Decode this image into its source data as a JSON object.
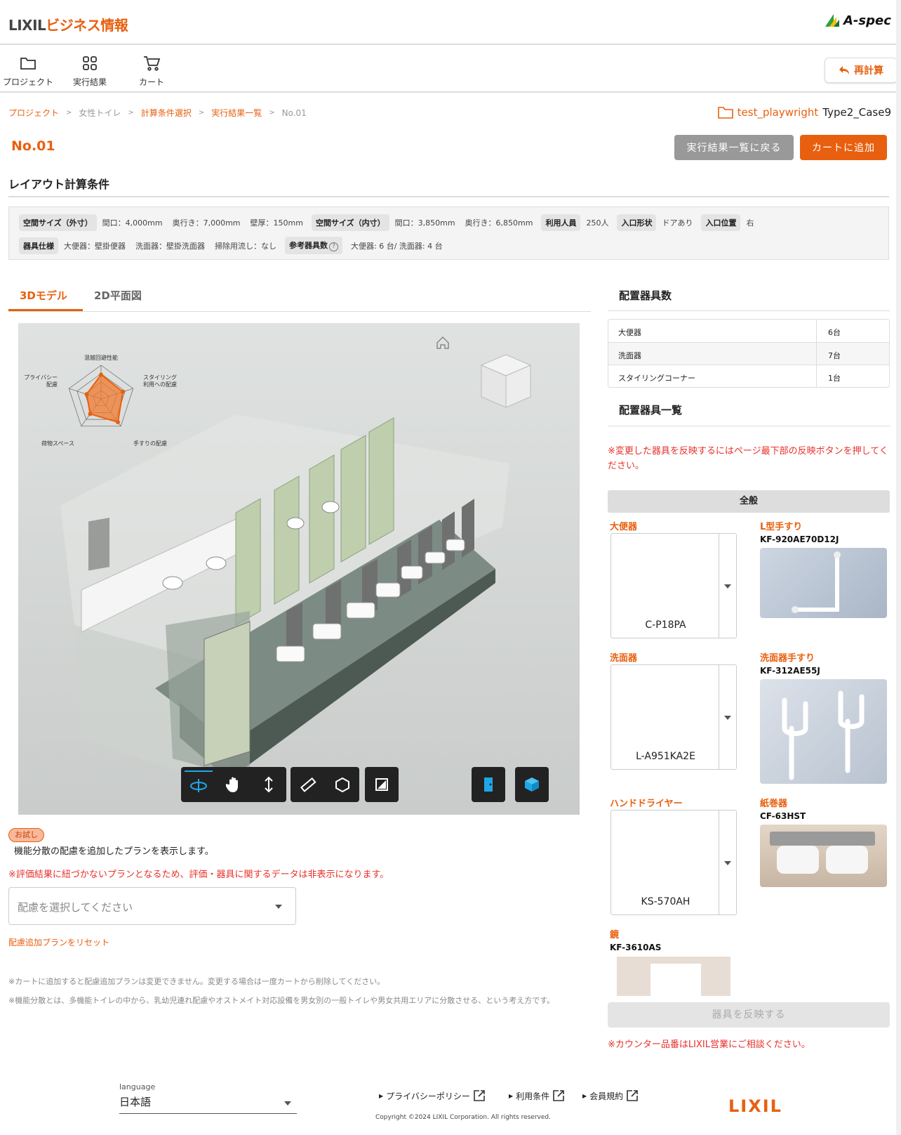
{
  "header": {
    "brand_lixil": "LIXIL",
    "brand_suffix": "ビジネス情報",
    "aspec": "A-spec"
  },
  "nav": {
    "project": "プロジェクト",
    "results": "実行結果",
    "cart": "カート",
    "recalc": "再計算"
  },
  "breadcrumb": {
    "items": [
      "プロジェクト",
      "女性トイレ",
      "計算条件選択",
      "実行結果一覧",
      "No.01"
    ],
    "sep": ">"
  },
  "project": {
    "name": "test_playwright",
    "case": "Type2_Case9"
  },
  "page": {
    "number": "No.01",
    "back_label": "実行結果一覧に戻る",
    "add_cart_label": "カートに追加"
  },
  "conditions": {
    "title": "レイアウト計算条件",
    "outer_tag": "空間サイズ（外寸）",
    "outer_width": "間口：4,000mm",
    "outer_depth": "奥行き：7,000mm",
    "wall": "壁厚：150mm",
    "inner_tag": "空間サイズ（内寸）",
    "inner_width": "間口：3,850mm",
    "inner_depth": "奥行き：6,850mm",
    "users_tag": "利用人員",
    "users": "250人",
    "entrance_tag": "入口形状",
    "entrance": "ドアあり",
    "entrance_pos_tag": "入口位置",
    "entrance_pos": "右",
    "spec_tag": "器具仕様",
    "spec_toilet": "大便器：壁掛便器",
    "spec_basin": "洗面器：壁掛洗面器",
    "spec_clean": "掃除用流し：なし",
    "ref_tag": "参考器具数",
    "ref_help": "?",
    "ref_value": "大便器: 6 台/ 洗面器: 4 台"
  },
  "tabs": {
    "model3d": "3Dモデル",
    "plan2d": "2D平面図"
  },
  "radar": {
    "axes": [
      "混雑回避性能",
      "スタイリング\n利用への配慮",
      "手すりの配慮",
      "荷物スペース",
      "プライバシー\n配慮"
    ],
    "axis_lines": [
      [
        "混雑回避性能"
      ],
      [
        "スタイリング",
        "利用への配慮"
      ],
      [
        "手すりの配慮"
      ],
      [
        "荷物スペース"
      ],
      [
        "プライバシー",
        "配慮"
      ]
    ],
    "values": [
      0.72,
      0.68,
      0.85,
      0.55,
      0.45
    ],
    "fill": "#f07a2d",
    "stroke": "#e8600f"
  },
  "trial": {
    "badge": "お試し",
    "desc": "機能分散の配慮を追加したプランを表示します。",
    "warn": "※評価結果に紐づかないプランとなるため、評価・器具に関するデータは非表示になります。",
    "select_placeholder": "配慮を選択してください",
    "reset": "配慮追加プランをリセット",
    "note1": "※カートに追加すると配慮追加プランは変更できません。変更する場合は一度カートから削除してください。",
    "note2": "※機能分散とは、多機能トイレの中から、乳幼児連れ配慮やオストメイト対応設備を男女別の一般トイレや男女共用エリアに分散させる、という考え方です。"
  },
  "fixture_count": {
    "title": "配置器具数",
    "rows": [
      {
        "name": "大便器",
        "count": "6台"
      },
      {
        "name": "洗面器",
        "count": "7台"
      },
      {
        "name": "スタイリングコーナー",
        "count": "1台"
      }
    ]
  },
  "fixture_list": {
    "title": "配置器具一覧",
    "note": "※変更した器具を反映するにはページ最下部の反映ボタンを押してください。",
    "category": "全般",
    "toilet_label": "大便器",
    "toilet_value": "C-P18PA",
    "l_rail_label": "L型手すり",
    "l_rail_code": "KF-920AE70D12J",
    "basin_label": "洗面器",
    "basin_value": "L-A951KA2E",
    "basin_rail_label": "洗面器手すり",
    "basin_rail_code": "KF-312AE55J",
    "dryer_label": "ハンドドライヤー",
    "dryer_value": "KS-570AH",
    "paper_label": "紙巻器",
    "paper_code": "CF-63HST",
    "mirror_label": "鏡",
    "mirror_code": "KF-3610AS",
    "reflect": "器具を反映する",
    "counter_note": "※カウンター品番はLIXIL営業にご相談ください。"
  },
  "footer": {
    "lang_label": "language",
    "lang_value": "日本語",
    "links": [
      "プライバシーポリシー",
      "利用条件",
      "会員規約"
    ],
    "copyright": "Copyright ©2024 LIXIL Corporation. All rights reserved.",
    "logo": "LIXIL"
  },
  "colors": {
    "accent": "#e8600f",
    "warning": "#e8302a",
    "viewer_bg": "#d5d8d6"
  },
  "icons": [
    "folder-icon",
    "grid-icon",
    "cart-icon",
    "undo-icon",
    "home-icon",
    "orbit-icon",
    "pan-icon",
    "zoom-icon",
    "measure-icon",
    "section-icon",
    "fullscreen-icon",
    "door-icon",
    "cube-icon",
    "external-link-icon"
  ]
}
